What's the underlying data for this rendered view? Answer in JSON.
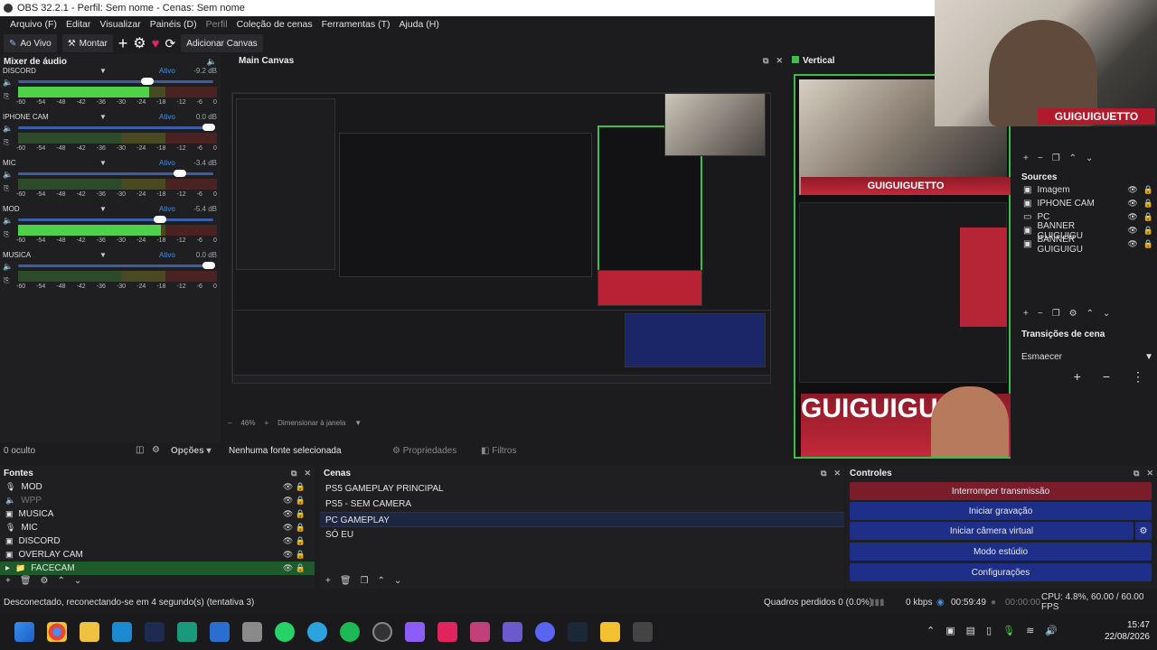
{
  "window": {
    "title": "OBS 32.2.1 - Perfil: Sem nome - Cenas: Sem nome"
  },
  "menu": [
    "Arquivo (F)",
    "Editar",
    "Visualizar",
    "Painéis (D)",
    "Perfil",
    "Coleção de cenas",
    "Ferramentas (T)",
    "Ajuda (H)"
  ],
  "toolbar": {
    "live_label": "Ao Vivo",
    "build_label": "Montar",
    "add_canvas_label": "Adicionar Canvas"
  },
  "mixer": {
    "title": "Mixer de áudio",
    "scale": [
      "-60",
      "-54",
      "-48",
      "-42",
      "-36",
      "-30",
      "-24",
      "-18",
      "-12",
      "-6",
      "0"
    ],
    "channels": [
      {
        "name": "DISCORD",
        "status": "Ativo",
        "db": "-9.2 dB",
        "level": 0.66
      },
      {
        "name": "IPHONE CAM",
        "status": "Ativo",
        "db": "0.0 dB",
        "level": 0.0
      },
      {
        "name": "MIC",
        "status": "Ativo",
        "db": "-3.4 dB",
        "level": 0.0
      },
      {
        "name": "MOD",
        "status": "Ativo",
        "db": "-5.4 dB",
        "level": 0.72
      },
      {
        "name": "MUSICA",
        "status": "Ativo",
        "db": "0.0 dB",
        "level": 0.0
      }
    ]
  },
  "main_canvas": {
    "title": "Main Canvas",
    "zoom": "46%",
    "fit_label": "Dimensionar à janela"
  },
  "vertical": {
    "title": "Vertical",
    "banner_text": "GUIGUIGUETTO",
    "big_text": "GUIGUIGUG"
  },
  "preview_footer": {
    "hidden_count": "0 oculto",
    "options_label": "Opções",
    "no_source": "Nenhuma fonte selecionada",
    "properties": "Propriedades",
    "filters": "Filtros"
  },
  "right_panel": {
    "sources_title": "Sources",
    "sources": [
      {
        "name": "Imagem",
        "icon": "image-icon"
      },
      {
        "name": "IPHONE CAM",
        "icon": "camera-icon"
      },
      {
        "name": "PC",
        "icon": "display-icon"
      },
      {
        "name": "BANNER GUIGUIGU",
        "icon": "image-icon"
      },
      {
        "name": "BANNER GUIGUIGU",
        "icon": "image-icon"
      }
    ],
    "transitions_title": "Transições de cena",
    "transition_value": "Esmaecer"
  },
  "fontes": {
    "title": "Fontes",
    "items": [
      {
        "name": "MOD",
        "icon": "mic-icon",
        "selected": false,
        "dim": false
      },
      {
        "name": "WPP",
        "icon": "speaker-icon",
        "selected": false,
        "dim": true
      },
      {
        "name": "MUSICA",
        "icon": "window-icon",
        "selected": false,
        "dim": false
      },
      {
        "name": "MIC",
        "icon": "mic-icon",
        "selected": false,
        "dim": false
      },
      {
        "name": "DISCORD",
        "icon": "window-icon",
        "selected": false,
        "dim": false
      },
      {
        "name": "OVERLAY CAM",
        "icon": "window-icon",
        "selected": false,
        "dim": false
      },
      {
        "name": "FACECAM",
        "icon": "folder-icon",
        "selected": true,
        "dim": false
      }
    ]
  },
  "cenas": {
    "title": "Cenas",
    "items": [
      "PS5 GAMEPLAY PRINCIPAL",
      "PS5 - SEM CAMERA",
      "PC GAMEPLAY",
      "SÓ EU"
    ],
    "selected_index": 2
  },
  "controles": {
    "title": "Controles",
    "buttons": [
      "Interromper transmissão",
      "Iniciar gravação",
      "Iniciar câmera virtual",
      "Modo estúdio",
      "Configurações"
    ]
  },
  "status": {
    "message": "Desconectado, reconectando-se em 4 segundo(s) (tentativa 3)",
    "dropped": "Quadros perdidos 0 (0.0%)",
    "kbps": "0 kbps",
    "live_time": "00:59:49",
    "rec_time": "00:00:00",
    "cpu": "CPU: 4.8%, 60.00 / 60.00 FPS"
  },
  "taskbar": {
    "time": "15:47",
    "date": "22/08/2026"
  },
  "colors": {
    "accent_blue": "#1e2f8a",
    "stop_red": "#7a1c2a",
    "active_green": "#3cbf4a"
  }
}
